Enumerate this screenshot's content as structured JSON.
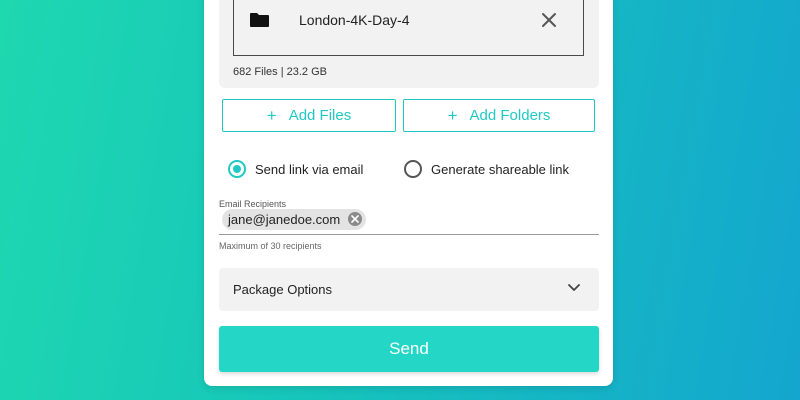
{
  "file_item": {
    "name": "London-4K-Day-4",
    "icon": "folder-icon",
    "remove_icon": "close-icon"
  },
  "file_summary": "682 Files | 23.2 GB",
  "buttons": {
    "add_files": "Add Files",
    "add_folders": "Add Folders",
    "plus": "+",
    "send": "Send"
  },
  "delivery": {
    "options": [
      {
        "label": "Send link via email",
        "selected": true
      },
      {
        "label": "Generate shareable link",
        "selected": false
      }
    ]
  },
  "recipients": {
    "label": "Email Recipients",
    "chips": [
      "jane@janedoe.com"
    ],
    "hint": "Maximum of 30 recipients"
  },
  "package_options": {
    "label": "Package Options",
    "icon": "chevron-down-icon"
  },
  "colors": {
    "accent": "#21c9c4",
    "send_button": "#24d6c6",
    "background_start": "#1ed8b0",
    "background_end": "#14a6cf"
  }
}
